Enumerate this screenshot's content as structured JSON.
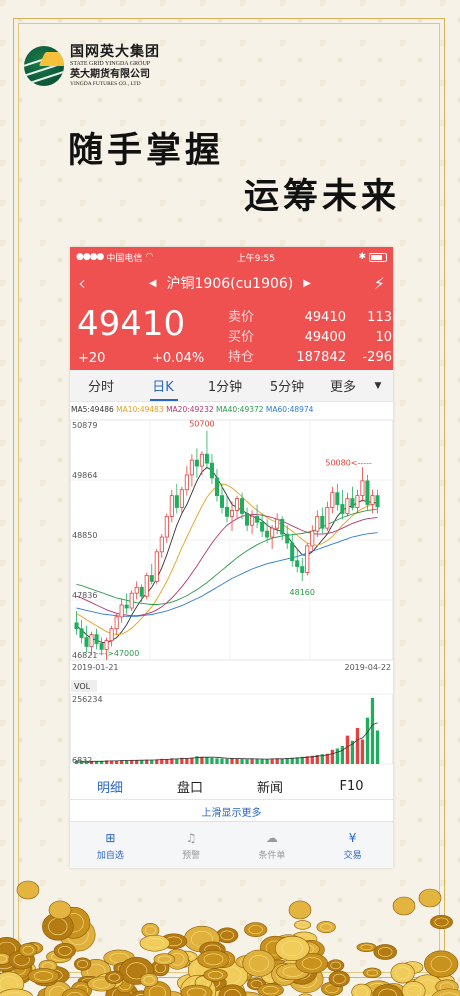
{
  "brand": {
    "name_cn": "国网英大集团",
    "name_en": "STATE GRID YINGDA GROUP",
    "sub_cn": "英大期货有限公司",
    "sub_en": "YINGDA FUTURES CO., LTD"
  },
  "slogan": {
    "line1": "随手掌握",
    "line2": "运筹未来"
  },
  "status_bar": {
    "carrier": "中国电信",
    "time": "上午9:55"
  },
  "instrument": {
    "title": "沪铜1906(cu1906)"
  },
  "quote": {
    "price": "49410",
    "change": "+20",
    "change_pct": "+0.04%",
    "rows": [
      {
        "label": "卖价",
        "v1": "49410",
        "v2": "113"
      },
      {
        "label": "买价",
        "v1": "49400",
        "v2": "10"
      },
      {
        "label": "持仓",
        "v1": "187842",
        "v2": "-296"
      }
    ]
  },
  "period_tabs": [
    "分时",
    "日K",
    "1分钟",
    "5分钟",
    "更多"
  ],
  "active_period": "日K",
  "ma_legend": {
    "ma5": "MA5:49486",
    "ma10": "MA10:49483",
    "ma20": "MA20:49232",
    "ma40": "MA40:49372",
    "ma60": "MA60:48974"
  },
  "colors": {
    "accent_red": "#ef5151",
    "up": "#e8413d",
    "down": "#1fae5d",
    "ma5": "#333333",
    "ma10": "#e6a021",
    "ma20": "#b8346c",
    "ma40": "#2a9a4a",
    "ma60": "#2f7bd3",
    "link_blue": "#2a66c8"
  },
  "chart_data": {
    "type": "candlestick",
    "y_ticks": [
      "50879",
      "49864",
      "48850",
      "47836",
      "46821"
    ],
    "ylim": [
      46821,
      50879
    ],
    "x_labels": [
      "2019-01-21",
      "2019-04-22"
    ],
    "annotations": [
      {
        "label": "50700",
        "value": 50700
      },
      {
        "label": "50080<-----",
        "value": 50080
      },
      {
        "label": "48160",
        "value": 48160
      },
      {
        "label": "---->47000",
        "value": 47000
      }
    ],
    "candles": [
      {
        "o": 47450,
        "h": 47650,
        "l": 47250,
        "c": 47350
      },
      {
        "o": 47350,
        "h": 47500,
        "l": 47100,
        "c": 47200
      },
      {
        "o": 47200,
        "h": 47400,
        "l": 46950,
        "c": 47050
      },
      {
        "o": 47050,
        "h": 47300,
        "l": 46900,
        "c": 47250
      },
      {
        "o": 47250,
        "h": 47350,
        "l": 47000,
        "c": 47100
      },
      {
        "o": 47100,
        "h": 47200,
        "l": 46900,
        "c": 47000
      },
      {
        "o": 47000,
        "h": 47200,
        "l": 46821,
        "c": 47150
      },
      {
        "o": 47150,
        "h": 47400,
        "l": 47050,
        "c": 47350
      },
      {
        "o": 47350,
        "h": 47600,
        "l": 47250,
        "c": 47550
      },
      {
        "o": 47550,
        "h": 47850,
        "l": 47450,
        "c": 47750
      },
      {
        "o": 47750,
        "h": 47950,
        "l": 47600,
        "c": 47700
      },
      {
        "o": 47700,
        "h": 48000,
        "l": 47650,
        "c": 47950
      },
      {
        "o": 47950,
        "h": 48150,
        "l": 47850,
        "c": 48050
      },
      {
        "o": 48050,
        "h": 48100,
        "l": 47800,
        "c": 47900
      },
      {
        "o": 47900,
        "h": 48300,
        "l": 47850,
        "c": 48250
      },
      {
        "o": 48250,
        "h": 48450,
        "l": 48100,
        "c": 48150
      },
      {
        "o": 48150,
        "h": 48700,
        "l": 48100,
        "c": 48650
      },
      {
        "o": 48650,
        "h": 48950,
        "l": 48550,
        "c": 48900
      },
      {
        "o": 48900,
        "h": 49300,
        "l": 48800,
        "c": 49250
      },
      {
        "o": 49250,
        "h": 49700,
        "l": 49150,
        "c": 49600
      },
      {
        "o": 49600,
        "h": 49800,
        "l": 49300,
        "c": 49400
      },
      {
        "o": 49400,
        "h": 49750,
        "l": 49300,
        "c": 49700
      },
      {
        "o": 49700,
        "h": 50100,
        "l": 49600,
        "c": 49950
      },
      {
        "o": 49950,
        "h": 50300,
        "l": 49750,
        "c": 50200
      },
      {
        "o": 50200,
        "h": 50400,
        "l": 49900,
        "c": 50100
      },
      {
        "o": 50100,
        "h": 50350,
        "l": 49950,
        "c": 50300
      },
      {
        "o": 50300,
        "h": 50700,
        "l": 50050,
        "c": 50150
      },
      {
        "o": 50150,
        "h": 50300,
        "l": 49800,
        "c": 49900
      },
      {
        "o": 49900,
        "h": 50050,
        "l": 49500,
        "c": 49600
      },
      {
        "o": 49600,
        "h": 49800,
        "l": 49300,
        "c": 49400
      },
      {
        "o": 49400,
        "h": 49600,
        "l": 49150,
        "c": 49250
      },
      {
        "o": 49250,
        "h": 49500,
        "l": 49000,
        "c": 49350
      },
      {
        "o": 49350,
        "h": 49600,
        "l": 49200,
        "c": 49550
      },
      {
        "o": 49550,
        "h": 49650,
        "l": 49200,
        "c": 49300
      },
      {
        "o": 49300,
        "h": 49400,
        "l": 49000,
        "c": 49100
      },
      {
        "o": 49100,
        "h": 49350,
        "l": 48950,
        "c": 49250
      },
      {
        "o": 49250,
        "h": 49450,
        "l": 49050,
        "c": 49150
      },
      {
        "o": 49150,
        "h": 49300,
        "l": 48900,
        "c": 49000
      },
      {
        "o": 49000,
        "h": 49200,
        "l": 48800,
        "c": 48900
      },
      {
        "o": 48900,
        "h": 49100,
        "l": 48700,
        "c": 49050
      },
      {
        "o": 49050,
        "h": 49300,
        "l": 48950,
        "c": 49200
      },
      {
        "o": 49200,
        "h": 49250,
        "l": 48850,
        "c": 48950
      },
      {
        "o": 48950,
        "h": 49100,
        "l": 48700,
        "c": 48800
      },
      {
        "o": 48800,
        "h": 48950,
        "l": 48400,
        "c": 48500
      },
      {
        "o": 48500,
        "h": 48700,
        "l": 48300,
        "c": 48400
      },
      {
        "o": 48400,
        "h": 48550,
        "l": 48160,
        "c": 48300
      },
      {
        "o": 48300,
        "h": 48800,
        "l": 48250,
        "c": 48750
      },
      {
        "o": 48750,
        "h": 49100,
        "l": 48650,
        "c": 49000
      },
      {
        "o": 49000,
        "h": 49350,
        "l": 48900,
        "c": 49250
      },
      {
        "o": 49250,
        "h": 49400,
        "l": 48950,
        "c": 49050
      },
      {
        "o": 49050,
        "h": 49500,
        "l": 49000,
        "c": 49400
      },
      {
        "o": 49400,
        "h": 49750,
        "l": 49300,
        "c": 49650
      },
      {
        "o": 49650,
        "h": 49800,
        "l": 49350,
        "c": 49450
      },
      {
        "o": 49450,
        "h": 49700,
        "l": 49200,
        "c": 49300
      },
      {
        "o": 49300,
        "h": 49650,
        "l": 49250,
        "c": 49550
      },
      {
        "o": 49550,
        "h": 49750,
        "l": 49350,
        "c": 49400
      },
      {
        "o": 49400,
        "h": 49700,
        "l": 49300,
        "c": 49600
      },
      {
        "o": 49600,
        "h": 50080,
        "l": 49500,
        "c": 49850
      },
      {
        "o": 49850,
        "h": 49950,
        "l": 49350,
        "c": 49450
      },
      {
        "o": 49450,
        "h": 49700,
        "l": 49300,
        "c": 49600
      },
      {
        "o": 49600,
        "h": 49700,
        "l": 49300,
        "c": 49410
      }
    ],
    "ma_lines": {
      "ma5": [
        47400,
        47330,
        47250,
        47180,
        47160,
        47120,
        47110,
        47150,
        47200,
        47300,
        47420,
        47580,
        47720,
        47850,
        47950,
        48050,
        48200,
        48380,
        48600,
        48850,
        49100,
        49300,
        49450,
        49650,
        49850,
        50000,
        50080,
        50030,
        49900,
        49750,
        49600,
        49450,
        49400,
        49350,
        49300,
        49250,
        49220,
        49180,
        49100,
        49050,
        49020,
        48990,
        48920,
        48800,
        48700,
        48600,
        48590,
        48650,
        48750,
        48850,
        48950,
        49100,
        49250,
        49350,
        49400,
        49430,
        49480,
        49520,
        49500,
        49480,
        49486
      ],
      "ma10": [
        47600,
        47560,
        47500,
        47450,
        47400,
        47350,
        47300,
        47270,
        47250,
        47260,
        47300,
        47360,
        47440,
        47530,
        47620,
        47720,
        47850,
        48000,
        48150,
        48330,
        48520,
        48720,
        48900,
        49080,
        49250,
        49420,
        49570,
        49680,
        49760,
        49800,
        49780,
        49730,
        49660,
        49580,
        49500,
        49420,
        49350,
        49290,
        49230,
        49180,
        49150,
        49110,
        49060,
        49000,
        48930,
        48860,
        48800,
        48770,
        48760,
        48790,
        48840,
        48910,
        49000,
        49100,
        49180,
        49260,
        49330,
        49380,
        49420,
        49460,
        49483
      ],
      "ma20": [
        47900,
        47870,
        47830,
        47790,
        47750,
        47710,
        47670,
        47640,
        47610,
        47590,
        47580,
        47570,
        47570,
        47580,
        47600,
        47630,
        47670,
        47720,
        47790,
        47870,
        47960,
        48060,
        48170,
        48290,
        48410,
        48540,
        48670,
        48800,
        48910,
        49010,
        49100,
        49160,
        49210,
        49250,
        49270,
        49280,
        49280,
        49270,
        49250,
        49230,
        49200,
        49170,
        49130,
        49090,
        49050,
        49010,
        48980,
        48960,
        48950,
        48950,
        48960,
        48980,
        49010,
        49050,
        49090,
        49130,
        49160,
        49190,
        49210,
        49220,
        49232
      ],
      "ma40": [
        48100,
        48080,
        48050,
        48020,
        47990,
        47960,
        47930,
        47900,
        47870,
        47850,
        47830,
        47810,
        47790,
        47780,
        47770,
        47760,
        47760,
        47770,
        47780,
        47800,
        47830,
        47870,
        47910,
        47960,
        48010,
        48070,
        48130,
        48200,
        48270,
        48340,
        48410,
        48480,
        48550,
        48610,
        48670,
        48720,
        48770,
        48810,
        48850,
        48880,
        48900,
        48920,
        48930,
        48940,
        48950,
        48960,
        48980,
        49000,
        49030,
        49070,
        49110,
        49150,
        49190,
        49230,
        49260,
        49290,
        49310,
        49330,
        49350,
        49360,
        49372
      ],
      "ma60": [
        47700,
        47680,
        47660,
        47640,
        47620,
        47600,
        47590,
        47580,
        47570,
        47560,
        47560,
        47560,
        47560,
        47570,
        47580,
        47590,
        47610,
        47630,
        47650,
        47680,
        47710,
        47740,
        47780,
        47820,
        47860,
        47900,
        47950,
        48000,
        48050,
        48100,
        48150,
        48200,
        48240,
        48280,
        48320,
        48360,
        48390,
        48420,
        48450,
        48470,
        48490,
        48510,
        48530,
        48550,
        48570,
        48600,
        48630,
        48660,
        48690,
        48720,
        48750,
        48780,
        48810,
        48840,
        48870,
        48900,
        48920,
        48940,
        48955,
        48965,
        48974
      ]
    },
    "volume": {
      "y_ticks": [
        "256234",
        "6832"
      ],
      "label": "VOL",
      "values": [
        12,
        10,
        9,
        11,
        10,
        12,
        14,
        13,
        12,
        15,
        14,
        16,
        15,
        14,
        17,
        16,
        18,
        20,
        19,
        22,
        20,
        24,
        23,
        25,
        30,
        28,
        26,
        24,
        22,
        21,
        20,
        22,
        21,
        19,
        18,
        20,
        21,
        19,
        18,
        20,
        22,
        21,
        23,
        24,
        26,
        28,
        30,
        32,
        35,
        38,
        40,
        55,
        60,
        70,
        110,
        90,
        140,
        95,
        180,
        256,
        130,
        120
      ],
      "up_flags": [
        0,
        0,
        0,
        1,
        0,
        0,
        1,
        1,
        1,
        1,
        0,
        1,
        1,
        0,
        1,
        0,
        1,
        1,
        1,
        1,
        0,
        1,
        1,
        1,
        0,
        1,
        0,
        0,
        0,
        0,
        0,
        1,
        1,
        0,
        0,
        1,
        0,
        0,
        0,
        1,
        1,
        0,
        0,
        0,
        0,
        0,
        1,
        1,
        1,
        0,
        1,
        1,
        0,
        0,
        1,
        0,
        1,
        1,
        0,
        0,
        0,
        0
      ]
    }
  },
  "bottom_tabs": [
    "明细",
    "盘口",
    "新闻",
    "F10"
  ],
  "active_bottom_tab": "明细",
  "hint": "上滑显示更多",
  "toolbar": [
    {
      "icon": "add-watchlist-icon",
      "label": "加自选"
    },
    {
      "icon": "bell-icon",
      "label": "预警"
    },
    {
      "icon": "cloud-icon",
      "label": "条件单"
    },
    {
      "icon": "yen-icon",
      "label": "交易"
    }
  ]
}
